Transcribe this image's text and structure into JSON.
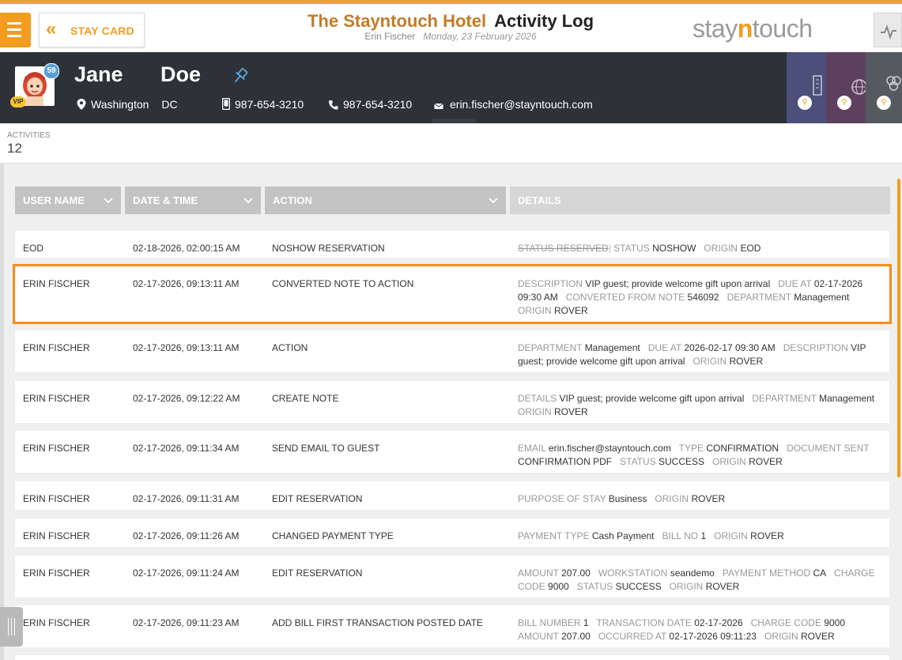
{
  "header": {
    "stay_card_label": "STAY CARD",
    "hotel_name": "The Stayntouch Hotel",
    "page_title": "Activity Log",
    "user": "Erin Fischer",
    "date": "Monday, 23 February 2026",
    "brand_pre": "stay",
    "brand_n": "n",
    "brand_post": "touch",
    "accent": "#f39c1f"
  },
  "guest": {
    "first_name": "Jane",
    "last_name": "Doe",
    "badge_count": "59",
    "vip": "VIP",
    "city": "Washington",
    "state": "DC",
    "mobile": "987-654-3210",
    "phone": "987-654-3210",
    "email": "erin.fischer@stayntouch.com",
    "tiles": [
      "building-icon",
      "globe-icon",
      "people-icon"
    ]
  },
  "activities": {
    "label": "ACTIVITIES",
    "count": "12"
  },
  "columns": {
    "user": "USER NAME",
    "date": "DATE & TIME",
    "action": "ACTION",
    "details": "DETAILS"
  },
  "rows": [
    {
      "user": "EOD",
      "date": "02-18-2026, 02:00:15 AM",
      "action": "NOSHOW RESERVATION",
      "details": [
        {
          "k": "STATUS",
          "v": "RESERVED",
          "strike": true
        },
        {
          "k": "STATUS",
          "v": "NOSHOW"
        },
        {
          "k": "ORIGIN",
          "v": "EOD"
        }
      ]
    },
    {
      "user": "ERIN FISCHER",
      "date": "02-17-2026, 09:13:11 AM",
      "action": "CONVERTED NOTE TO ACTION",
      "highlight": true,
      "details": [
        {
          "k": "DESCRIPTION",
          "v": "VIP guest; provide welcome gift upon arrival"
        },
        {
          "k": "DUE AT",
          "v": "02-17-2026 09:30 AM"
        },
        {
          "k": "CONVERTED FROM NOTE",
          "v": "546092"
        },
        {
          "k": "DEPARTMENT",
          "v": "Management"
        },
        {
          "k": "ORIGIN",
          "v": "ROVER"
        }
      ]
    },
    {
      "user": "ERIN FISCHER",
      "date": "02-17-2026, 09:13:11 AM",
      "action": "ACTION",
      "details": [
        {
          "k": "DEPARTMENT",
          "v": "Management"
        },
        {
          "k": "DUE AT",
          "v": "2026-02-17 09:30 AM"
        },
        {
          "k": "DESCRIPTION",
          "v": "VIP guest; provide welcome gift upon arrival"
        },
        {
          "k": "ORIGIN",
          "v": "ROVER"
        }
      ]
    },
    {
      "user": "ERIN FISCHER",
      "date": "02-17-2026, 09:12:22 AM",
      "action": "CREATE NOTE",
      "details": [
        {
          "k": "DETAILS",
          "v": "VIP guest; provide welcome gift upon arrival"
        },
        {
          "k": "DEPARTMENT",
          "v": "Management"
        },
        {
          "k": "ORIGIN",
          "v": "ROVER"
        }
      ]
    },
    {
      "user": "ERIN FISCHER",
      "date": "02-17-2026, 09:11:34 AM",
      "action": "SEND EMAIL TO GUEST",
      "details": [
        {
          "k": "EMAIL",
          "v": "erin.fischer@stayntouch.com"
        },
        {
          "k": "TYPE",
          "v": "CONFIRMATION"
        },
        {
          "k": "DOCUMENT SENT",
          "v": "CONFIRMATION PDF"
        },
        {
          "k": "STATUS",
          "v": "SUCCESS"
        },
        {
          "k": "ORIGIN",
          "v": "ROVER"
        }
      ]
    },
    {
      "user": "ERIN FISCHER",
      "date": "02-17-2026, 09:11:31 AM",
      "action": "EDIT RESERVATION",
      "details": [
        {
          "k": "PURPOSE OF STAY",
          "v": "Business"
        },
        {
          "k": "ORIGIN",
          "v": "ROVER"
        }
      ]
    },
    {
      "user": "ERIN FISCHER",
      "date": "02-17-2026, 09:11:26 AM",
      "action": "CHANGED PAYMENT TYPE",
      "details": [
        {
          "k": "PAYMENT TYPE",
          "v": "Cash Payment"
        },
        {
          "k": "BILL NO",
          "v": "1"
        },
        {
          "k": "ORIGIN",
          "v": "ROVER"
        }
      ]
    },
    {
      "user": "ERIN FISCHER",
      "date": "02-17-2026, 09:11:24 AM",
      "action": "EDIT RESERVATION",
      "details": [
        {
          "k": "AMOUNT",
          "v": "207.00"
        },
        {
          "k": "WORKSTATION",
          "v": "seandemo"
        },
        {
          "k": "PAYMENT METHOD",
          "v": "CA"
        },
        {
          "k": "CHARGE CODE",
          "v": "9000"
        },
        {
          "k": "STATUS",
          "v": "SUCCESS"
        },
        {
          "k": "ORIGIN",
          "v": "ROVER"
        }
      ]
    },
    {
      "user": "ERIN FISCHER",
      "date": "02-17-2026, 09:11:23 AM",
      "action": "ADD BILL FIRST TRANSACTION POSTED DATE",
      "details": [
        {
          "k": "BILL NUMBER",
          "v": "1"
        },
        {
          "k": "TRANSACTION DATE",
          "v": "02-17-2026"
        },
        {
          "k": "CHARGE CODE",
          "v": "9000"
        },
        {
          "k": "AMOUNT",
          "v": "207.00"
        },
        {
          "k": "OCCURRED AT",
          "v": "02-17-2026 09:11:23"
        },
        {
          "k": "ORIGIN",
          "v": "ROVER"
        }
      ]
    }
  ]
}
